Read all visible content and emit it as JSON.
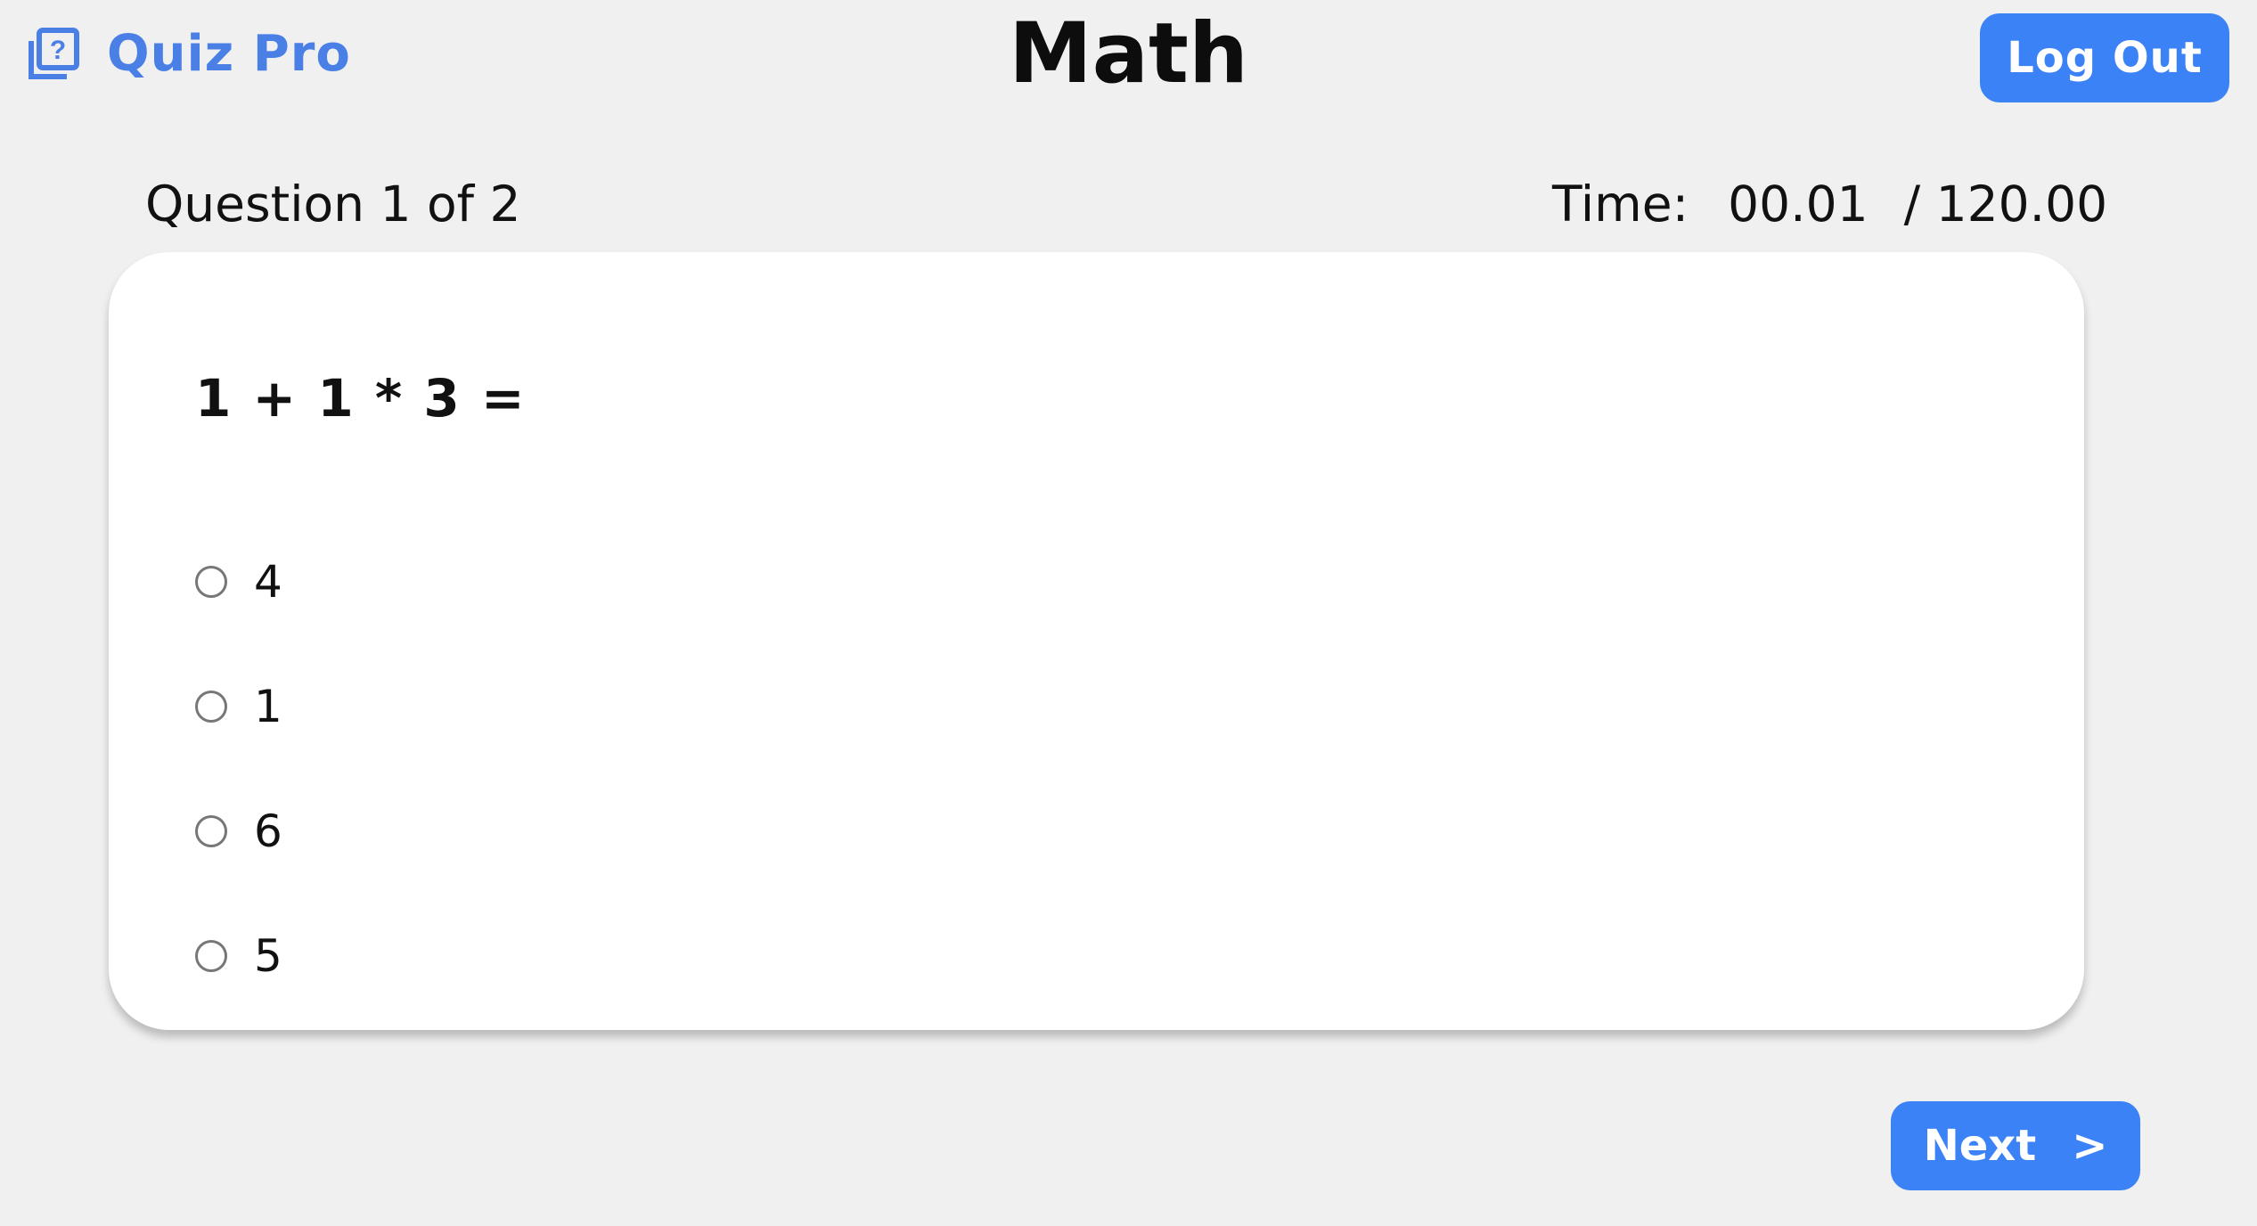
{
  "header": {
    "brand_name": "Quiz Pro",
    "brand_icon": "quiz-question-icon",
    "page_title": "Math",
    "logout_label": "Log Out"
  },
  "quiz": {
    "counter": "Question 1 of 2",
    "timer_label": "Time:",
    "timer_elapsed": "00.01",
    "timer_total": "/ 120.00",
    "question": "1 + 1 * 3 =",
    "options": [
      {
        "label": "4"
      },
      {
        "label": "1"
      },
      {
        "label": "6"
      },
      {
        "label": "5"
      }
    ]
  },
  "footer": {
    "next_label": "Next",
    "next_arrow": ">"
  },
  "colors": {
    "accent": "#3b82f6",
    "brand": "#4a7fe6",
    "background": "#f0f0f0",
    "card": "#ffffff"
  }
}
